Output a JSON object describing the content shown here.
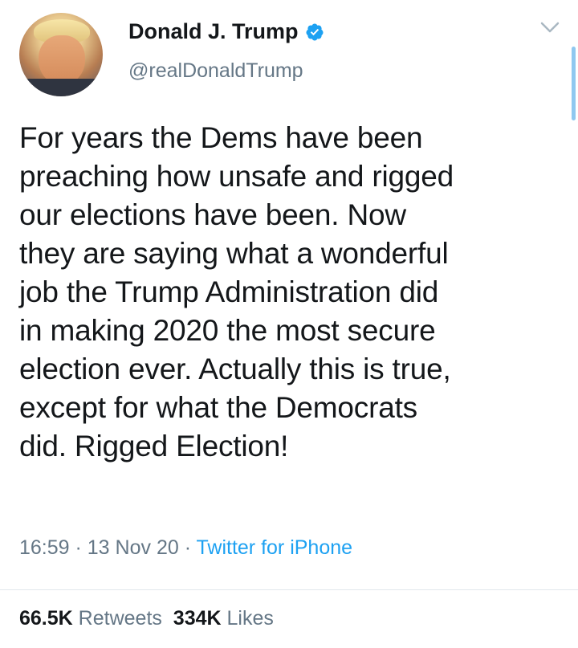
{
  "author": {
    "name": "Donald J. Trump",
    "handle": "@realDonaldTrump",
    "verified": true,
    "verified_icon": "verified-badge-icon"
  },
  "tweet": {
    "lines": [
      "For years the Dems have been",
      "preaching how unsafe and rigged",
      "our elections have been. Now",
      "they are saying what a wonderful",
      "job the Trump Administration did",
      "in making 2020 the most secure",
      "election ever. Actually this is true,",
      "except for what the Democrats",
      "did. Rigged Election!"
    ]
  },
  "meta": {
    "time": "16:59",
    "sep1": " · ",
    "date": "13 Nov 20",
    "sep2": " · ",
    "source": "Twitter for iPhone"
  },
  "stats": {
    "retweets_count": "66.5K",
    "retweets_label": "Retweets",
    "likes_count": "334K",
    "likes_label": "Likes"
  },
  "colors": {
    "accent": "#1da1f2",
    "text": "#14171a",
    "muted": "#657786"
  }
}
